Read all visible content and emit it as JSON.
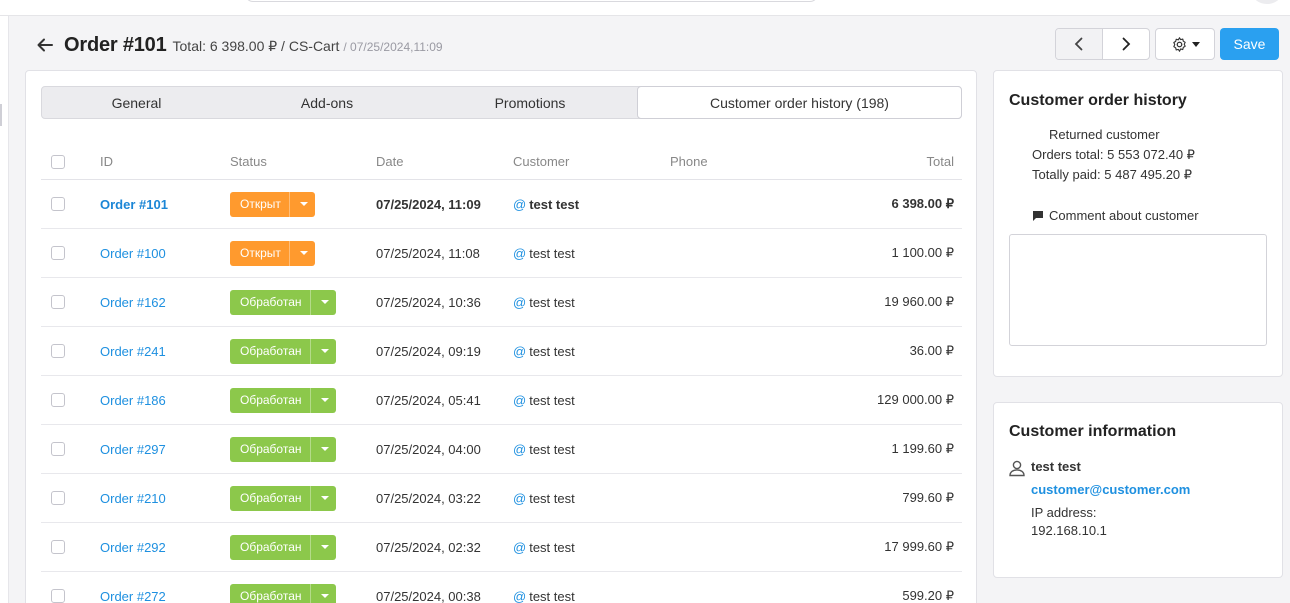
{
  "header": {
    "title": "Order #101",
    "meta": "Total: 6 398.00 ₽ / CS-Cart",
    "date": "/ 07/25/2024,11:09"
  },
  "toolbar": {
    "save_label": "Save"
  },
  "tabs": [
    {
      "label": "General"
    },
    {
      "label": "Add-ons"
    },
    {
      "label": "Promotions"
    },
    {
      "label": "Customer order history (198)"
    }
  ],
  "table": {
    "columns": {
      "id": "ID",
      "status": "Status",
      "date": "Date",
      "customer": "Customer",
      "phone": "Phone",
      "total": "Total"
    },
    "rows": [
      {
        "id": "Order #101",
        "status": "Открыт",
        "date": "07/25/2024, 11:09",
        "customer": "test test",
        "total": "6 398.00 ₽"
      },
      {
        "id": "Order #100",
        "status": "Открыт",
        "date": "07/25/2024, 11:08",
        "customer": "test test",
        "total": "1 100.00 ₽"
      },
      {
        "id": "Order #162",
        "status": "Обработан",
        "date": "07/25/2024, 10:36",
        "customer": "test test",
        "total": "19 960.00 ₽"
      },
      {
        "id": "Order #241",
        "status": "Обработан",
        "date": "07/25/2024, 09:19",
        "customer": "test test",
        "total": "36.00 ₽"
      },
      {
        "id": "Order #186",
        "status": "Обработан",
        "date": "07/25/2024, 05:41",
        "customer": "test test",
        "total": "129 000.00 ₽"
      },
      {
        "id": "Order #297",
        "status": "Обработан",
        "date": "07/25/2024, 04:00",
        "customer": "test test",
        "total": "1 199.60 ₽"
      },
      {
        "id": "Order #210",
        "status": "Обработан",
        "date": "07/25/2024, 03:22",
        "customer": "test test",
        "total": "799.60 ₽"
      },
      {
        "id": "Order #292",
        "status": "Обработан",
        "date": "07/25/2024, 02:32",
        "customer": "test test",
        "total": "17 999.60 ₽"
      },
      {
        "id": "Order #272",
        "status": "Обработан",
        "date": "07/25/2024, 00:38",
        "customer": "test test",
        "total": "599.20 ₽"
      }
    ]
  },
  "history_panel": {
    "title": "Customer order history",
    "returned": "Returned customer",
    "orders_total": "Orders total: 5 553 072.40 ₽",
    "totally_paid": "Totally paid: 5 487 495.20 ₽",
    "comment_label": "Comment about customer",
    "comment_value": ""
  },
  "customer_panel": {
    "title": "Customer information",
    "name": "test test",
    "email": "customer@customer.com",
    "ip_label": "IP address:",
    "ip_value": "192.168.10.1"
  },
  "colors": {
    "accent": "#2aa0f0",
    "link": "#1e90e0",
    "status_open": "#ff9a2e",
    "status_processed": "#8cc84b"
  },
  "icons": [
    "back-arrow-icon",
    "chevron-left-icon",
    "chevron-right-icon",
    "gear-icon",
    "comment-icon",
    "user-icon"
  ]
}
